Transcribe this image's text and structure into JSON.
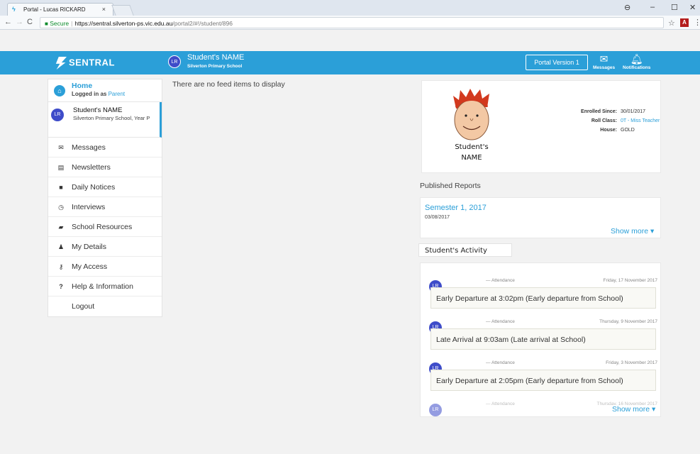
{
  "browser": {
    "tab_title": "Portal - Lucas RICKARD",
    "tab_close": "×",
    "secure_label": "Secure",
    "url_host": "https://sentral.silverton-ps.vic.edu.au",
    "url_path": "/portal2/#!/student/896"
  },
  "header": {
    "logo_text": "SENTRAL",
    "user_initials": "LR",
    "user_name": "Student's NAME",
    "user_school": "Silverton Primary School",
    "portal_version_label": "Portal Version 1",
    "messages_label": "Messages",
    "notifications_label": "Notifications"
  },
  "sidebar": {
    "home_label": "Home",
    "logged_in_prefix": "Logged in as",
    "logged_in_role": "Parent",
    "student_initials": "LR",
    "student_name": "Student's NAME",
    "student_detail": "Silverton Primary School, Year P",
    "items": [
      {
        "label": "Messages",
        "icon": "envelope-icon"
      },
      {
        "label": "Newsletters",
        "icon": "newspaper-icon"
      },
      {
        "label": "Daily Notices",
        "icon": "notice-icon"
      },
      {
        "label": "Interviews",
        "icon": "clock-icon"
      },
      {
        "label": "School Resources",
        "icon": "folder-icon"
      },
      {
        "label": "My Details",
        "icon": "user-icon"
      },
      {
        "label": "My Access",
        "icon": "key-icon"
      },
      {
        "label": "Help & Information",
        "icon": "question-icon"
      }
    ],
    "logout_label": "Logout"
  },
  "feed": {
    "empty_message": "There are no feed items to display"
  },
  "profile": {
    "name_line1": "Student's",
    "name_line2": "NAME",
    "enrolled_label": "Enrolled Since:",
    "enrolled_value": "30/01/2017",
    "roll_label": "Roll Class:",
    "roll_value": "0T - Miss Teacher",
    "house_label": "House:",
    "house_value": "GOLD"
  },
  "reports": {
    "section_title": "Published Reports",
    "items": [
      {
        "title": "Semester 1, 2017",
        "date": "03/08/2017"
      }
    ],
    "show_more": "Show more ▾"
  },
  "activity": {
    "tab_label": "Student's Activity",
    "items": [
      {
        "initials": "LR",
        "category": "— Attendance",
        "date": "Friday, 17 November 2017",
        "text": "Early Departure at 3:02pm (Early departure from School)"
      },
      {
        "initials": "LR",
        "category": "— Attendance",
        "date": "Thursday, 9 November 2017",
        "text": "Late Arrival at 9:03am (Late arrival at School)"
      },
      {
        "initials": "LR",
        "category": "— Attendance",
        "date": "Friday, 3 November 2017",
        "text": "Early Departure at 2:05pm (Early departure from School)"
      },
      {
        "initials": "LR",
        "category": "— Attendance",
        "date": "Thursday, 16 November 2017",
        "text": ""
      }
    ],
    "show_more": "Show more ▾"
  },
  "colors": {
    "brand_blue": "#2b9fd8",
    "avatar_indigo": "#3e4cc9"
  }
}
